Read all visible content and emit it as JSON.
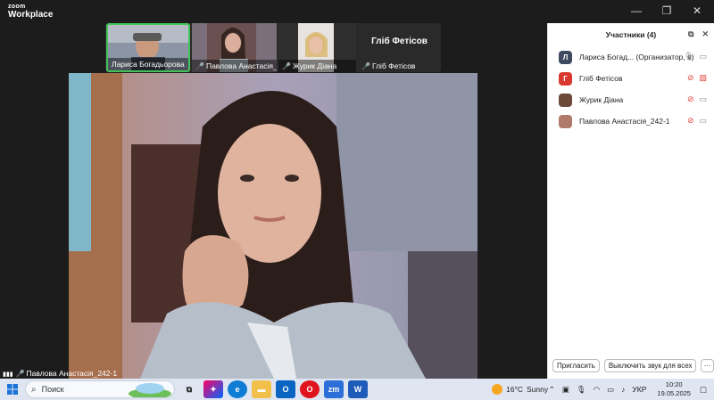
{
  "app": {
    "logo_top": "zoom",
    "logo_bottom": "Workplace"
  },
  "window_controls": {
    "minimize": "—",
    "restore": "❐",
    "close": "✕"
  },
  "thumbnails": [
    {
      "name": "Лариса Богадьорова",
      "muted": false,
      "active": true
    },
    {
      "name": "Павлова Анастасія_2...",
      "muted": true,
      "active": false
    },
    {
      "name": "Журик Діана",
      "muted": true,
      "active": false
    },
    {
      "name": "Гліб Фетісов",
      "muted": true,
      "active": false,
      "card_title": "Гліб Фетісов"
    }
  ],
  "main_video": {
    "label": "Павлова Анастасія_242-1"
  },
  "participants_panel": {
    "title": "Участники (4)",
    "participants": [
      {
        "initial": "Л",
        "name": "Лариса Богад... (Организатор, я)",
        "color": "#3e4a62",
        "mic_muted": false,
        "video_off": false
      },
      {
        "initial": "Г",
        "name": "Гліб Фетісов",
        "color": "#d8382e",
        "mic_muted": true,
        "video_off": true
      },
      {
        "initial": "",
        "name": "Журик Діана",
        "color": "#6b4a3a",
        "mic_muted": true,
        "video_off": false
      },
      {
        "initial": "",
        "name": "Павлова Анастасія_242-1",
        "color": "#b07a6a",
        "mic_muted": true,
        "video_off": false
      }
    ],
    "invite_button": "Пригласить",
    "mute_all_button": "Выключить звук для всех",
    "more_button": "···"
  },
  "taskbar": {
    "search_placeholder": "Поиск",
    "weather": {
      "temp": "16°C",
      "condition": "Sunny"
    },
    "language": "УКР",
    "time": "10:20",
    "date": "19.05.2025"
  }
}
